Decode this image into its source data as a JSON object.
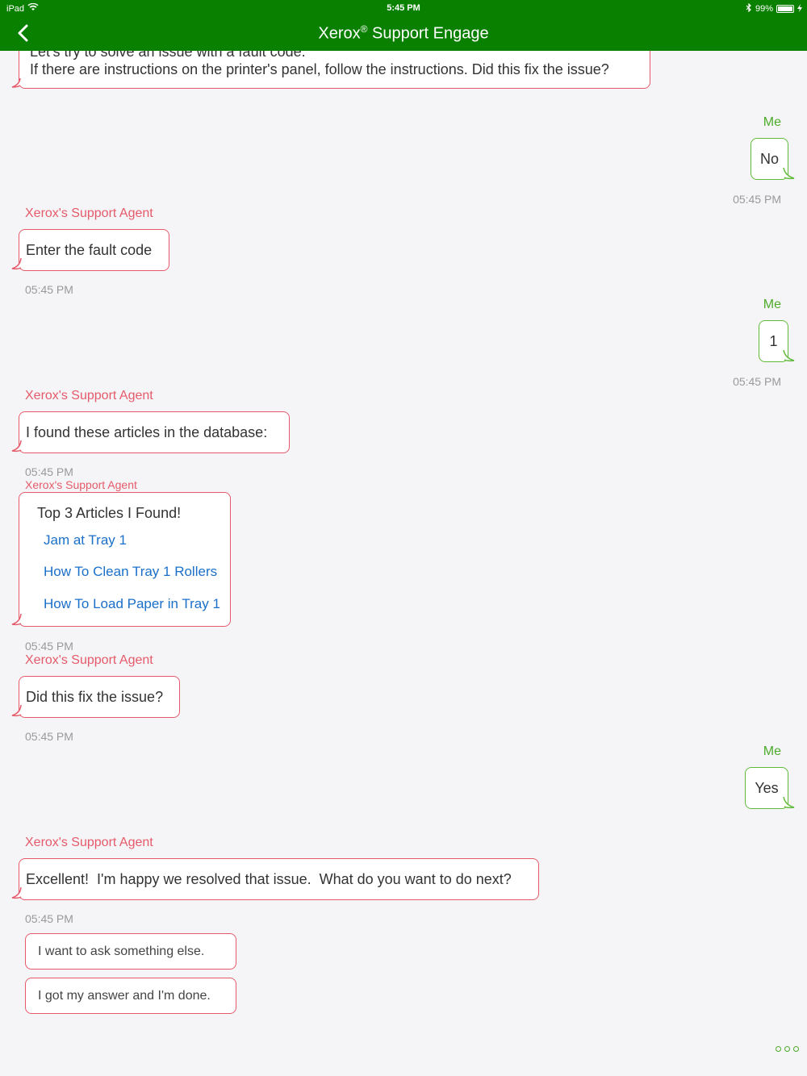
{
  "status_bar": {
    "device": "iPad",
    "time": "5:45 PM",
    "battery": "99%"
  },
  "nav": {
    "title_brand": "Xerox",
    "title_reg": "®",
    "title_rest": " Support Engage"
  },
  "messages": {
    "m0_text_line1": "Let's try to solve an issue with a fault code.",
    "m0_text_line2": "If there are instructions on the printer's panel, follow the instructions. Did this fix the issue?",
    "m1_sender": "Me",
    "m1_text": "No",
    "m1_time": "05:45 PM",
    "m2_sender": "Xerox's Support Agent",
    "m2_text": "Enter the fault code",
    "m2_time": "05:45 PM",
    "m3_sender": "Me",
    "m3_text": "1",
    "m3_time": "05:45 PM",
    "m4_sender": "Xerox's Support Agent",
    "m4_text": "I found these articles in the database:",
    "m4_time": "05:45 PM",
    "m5_sender": "Xerox's Support Agent",
    "m5_title": "Top 3 Articles I Found!",
    "m5_links": [
      "Jam at Tray 1",
      "How To Clean Tray 1 Rollers",
      "How To Load Paper in Tray 1"
    ],
    "m5_time": "05:45 PM",
    "m6_sender": "Xerox's Support Agent",
    "m6_text": "Did this fix the issue?",
    "m6_time": "05:45 PM",
    "m7_sender": "Me",
    "m7_text": "Yes",
    "m8_sender": "Xerox's Support Agent",
    "m8_text": "Excellent!  I'm happy we resolved that issue.  What do you want to do next?",
    "m8_time": "05:45 PM"
  },
  "options": [
    "I want to ask something else.",
    "I got my answer and I'm done."
  ],
  "colors": {
    "header": "#0a8000",
    "agent": "#e55a6a",
    "me": "#5fba3a",
    "link": "#1a6fc9"
  }
}
